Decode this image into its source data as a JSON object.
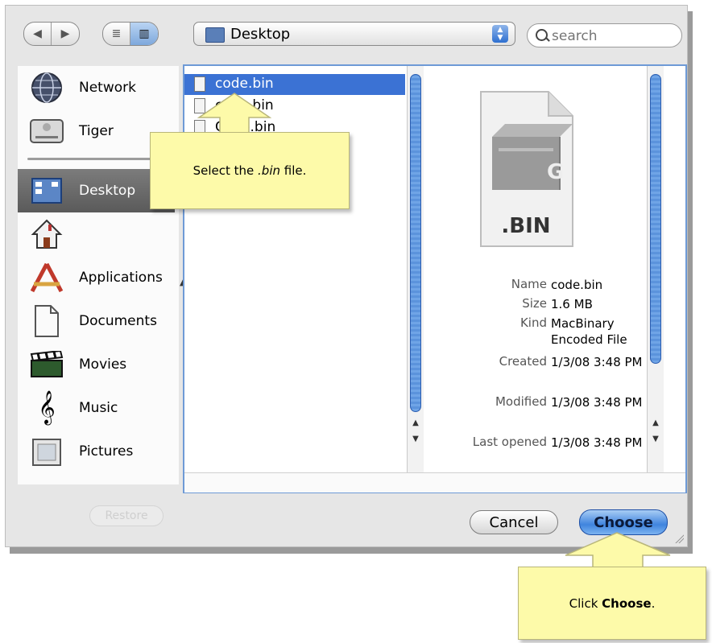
{
  "toolbar": {
    "back_icon": "back-arrow-icon",
    "forward_icon": "forward-arrow-icon",
    "list_view_icon": "list-view-icon",
    "column_view_icon": "column-view-icon",
    "location": "Desktop",
    "search_placeholder": "search"
  },
  "sidebar": {
    "items": [
      {
        "label": "Network",
        "icon": "network-globe-icon"
      },
      {
        "label": "Tiger",
        "icon": "hard-disk-icon"
      },
      {
        "label": "Desktop",
        "icon": "desktop-icon",
        "selected": true
      },
      {
        "label": "",
        "icon": "home-icon"
      },
      {
        "label": "Applications",
        "icon": "applications-icon"
      },
      {
        "label": "Documents",
        "icon": "documents-icon"
      },
      {
        "label": "Movies",
        "icon": "movies-clapper-icon"
      },
      {
        "label": "Music",
        "icon": "music-clef-icon"
      },
      {
        "label": "Pictures",
        "icon": "pictures-frame-icon"
      }
    ]
  },
  "files": [
    {
      "name": "code.bin",
      "selected": true
    },
    {
      "name": "code.bin"
    },
    {
      "name": "Code.bin"
    }
  ],
  "preview": {
    "extension_label": ".BIN",
    "info": [
      {
        "key": "Name",
        "value": "code.bin"
      },
      {
        "key": "Size",
        "value": "1.6 MB"
      },
      {
        "key": "Kind",
        "value": "MacBinary Encoded File"
      },
      {
        "key": "Created",
        "value": "1/3/08 3:48 PM"
      },
      {
        "key": "Modified",
        "value": "1/3/08 3:48 PM"
      },
      {
        "key": "Last opened",
        "value": "1/3/08 3:48 PM"
      }
    ]
  },
  "buttons": {
    "cancel": "Cancel",
    "choose": "Choose",
    "restore": "Restore"
  },
  "callouts": {
    "select_prefix": "Select the ",
    "select_emph": ".bin",
    "select_suffix": " file.",
    "click_prefix": "Click ",
    "click_emph": "Choose",
    "click_suffix": "."
  },
  "colors": {
    "selection": "#3b72d4",
    "callout": "#fdfaa9",
    "default_button": "#3f84de"
  }
}
